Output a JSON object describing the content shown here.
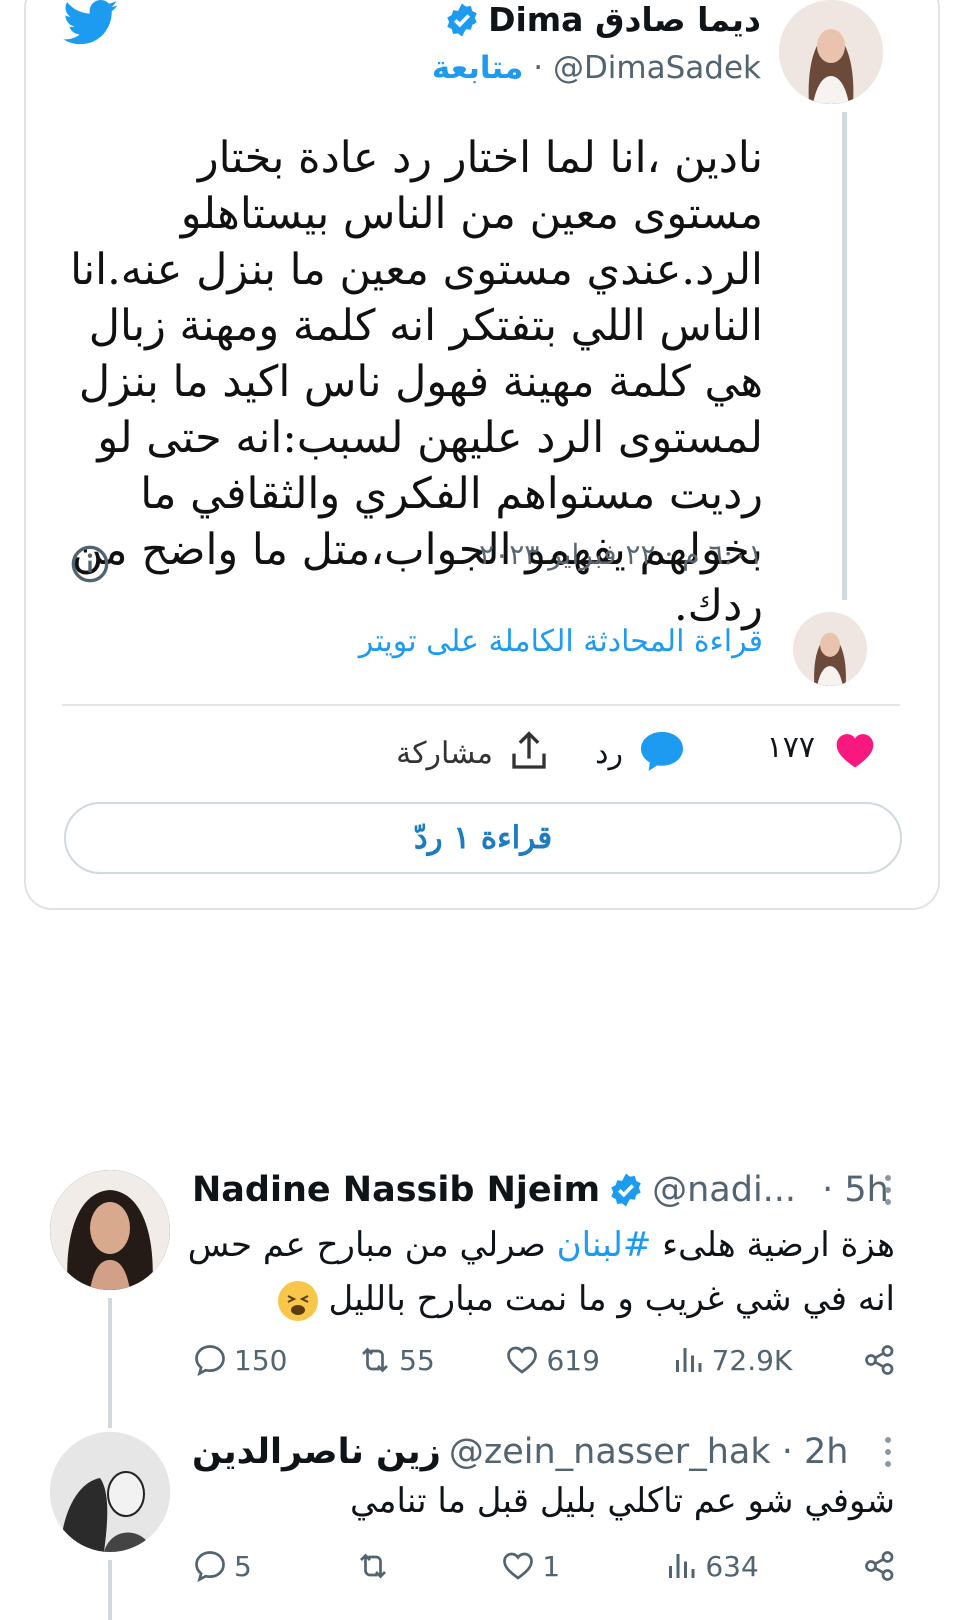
{
  "embed": {
    "author_name": "ديما صادق Dima",
    "author_handle": "@DimaSadek",
    "follow_label": "متابعة",
    "text": "نادين ،انا لما اختار رد عادة بختار مستوى معين من الناس بيستاهلو الرد.عندي مستوى معين ما بنزل عنه.انا الناس اللي بتفتكر انه كلمة ومهنة زبال هي كلمة مهينة فهول ناس اكيد ما بنزل لمستوى الرد عليهن لسبب:انه حتى لو رديت مستواهم الفكري والثقافي ما بخولهم يفهمو الجواب،متل ما واضح من ردك.",
    "timestamp": "٦:٠١ م · ٢٢ فبراير ٢٠٢٣",
    "read_conversation": "قراءة المحادثة الكاملة على تويتر",
    "likes": "١٧٧",
    "reply_label": "رد",
    "share_label": "مشاركة",
    "read_replies_button": "قراءة ١ ردّ"
  },
  "tweets": [
    {
      "name": "Nadine Nassib Njeim",
      "handle": "@nadi...",
      "time": "· 5h",
      "text_part1": "هزة ارضية هلىء ",
      "hashtag": "#لبنان",
      "text_part2": " صرلي من مبارح عم حس انه في شي غريب و ما نمت مبارح بالليل",
      "replies": "150",
      "retweets": "55",
      "likes": "619",
      "views": "72.9K"
    },
    {
      "name": "زين ناصرالدين",
      "handle": "@zein_nasser_hak · 2h",
      "text": "شوفي شو عم تاكلي بليل قبل ما تنامي",
      "replies": "5",
      "retweets": "",
      "likes": "1",
      "views": "634"
    }
  ],
  "colors": {
    "accent": "#1d9bf0",
    "like_pink": "#f91880",
    "text": "#0f1419",
    "muted": "#536471"
  }
}
